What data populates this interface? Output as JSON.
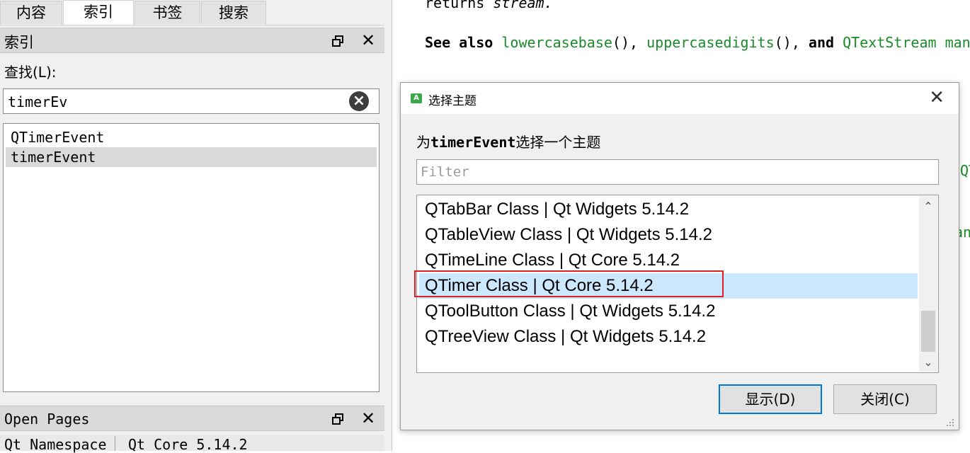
{
  "tabs": [
    {
      "label": "内容",
      "active": false
    },
    {
      "label": "索引",
      "active": true
    },
    {
      "label": "书签",
      "active": false
    },
    {
      "label": "搜索",
      "active": false
    }
  ],
  "index_dock": {
    "title": "索引",
    "find_label": "查找(L):",
    "search_value": "timerEv"
  },
  "index_results": [
    {
      "label": "QTimerEvent",
      "selected": false
    },
    {
      "label": "timerEvent",
      "selected": true
    }
  ],
  "open_pages": {
    "title": "Open Pages",
    "items": [
      "Qt Namespace",
      "Qt Core 5.14.2"
    ]
  },
  "doc": {
    "returns_prefix": "returns ",
    "returns_value": "stream.",
    "see_also_label": "See also",
    "link1": "lowercasebase",
    "parens": "()",
    "sep": ", ",
    "link2": "uppercasedigits",
    "and_word": "and",
    "link3": "QTextStream man",
    "frag1": "QT",
    "frag2": "an"
  },
  "dialog": {
    "title": "选择主题",
    "prompt_prefix": "为",
    "prompt_keyword": "timerEvent",
    "prompt_suffix": "选择一个主题",
    "filter_placeholder": "Filter",
    "topics": [
      {
        "label": "QTabBar Class | Qt Widgets 5.14.2",
        "selected": false
      },
      {
        "label": "QTableView Class | Qt Widgets 5.14.2",
        "selected": false
      },
      {
        "label": "QTimeLine Class | Qt Core 5.14.2",
        "selected": false
      },
      {
        "label": "QTimer Class | Qt Core 5.14.2",
        "selected": true
      },
      {
        "label": "QToolButton Class | Qt Widgets 5.14.2",
        "selected": false
      },
      {
        "label": "QTreeView Class | Qt Widgets 5.14.2",
        "selected": false
      }
    ],
    "show_button": "显示(D)",
    "close_button": "关闭(C)"
  },
  "colors": {
    "link": "#1a8a2a",
    "selection": "#cce8ff",
    "highlight_border": "#e02020",
    "default_button_border": "#0078d7"
  },
  "icons": [
    "clear-search-icon",
    "float-icon",
    "close-icon",
    "app-icon",
    "chevron-up-icon",
    "chevron-down-icon",
    "resize-grip-icon"
  ]
}
